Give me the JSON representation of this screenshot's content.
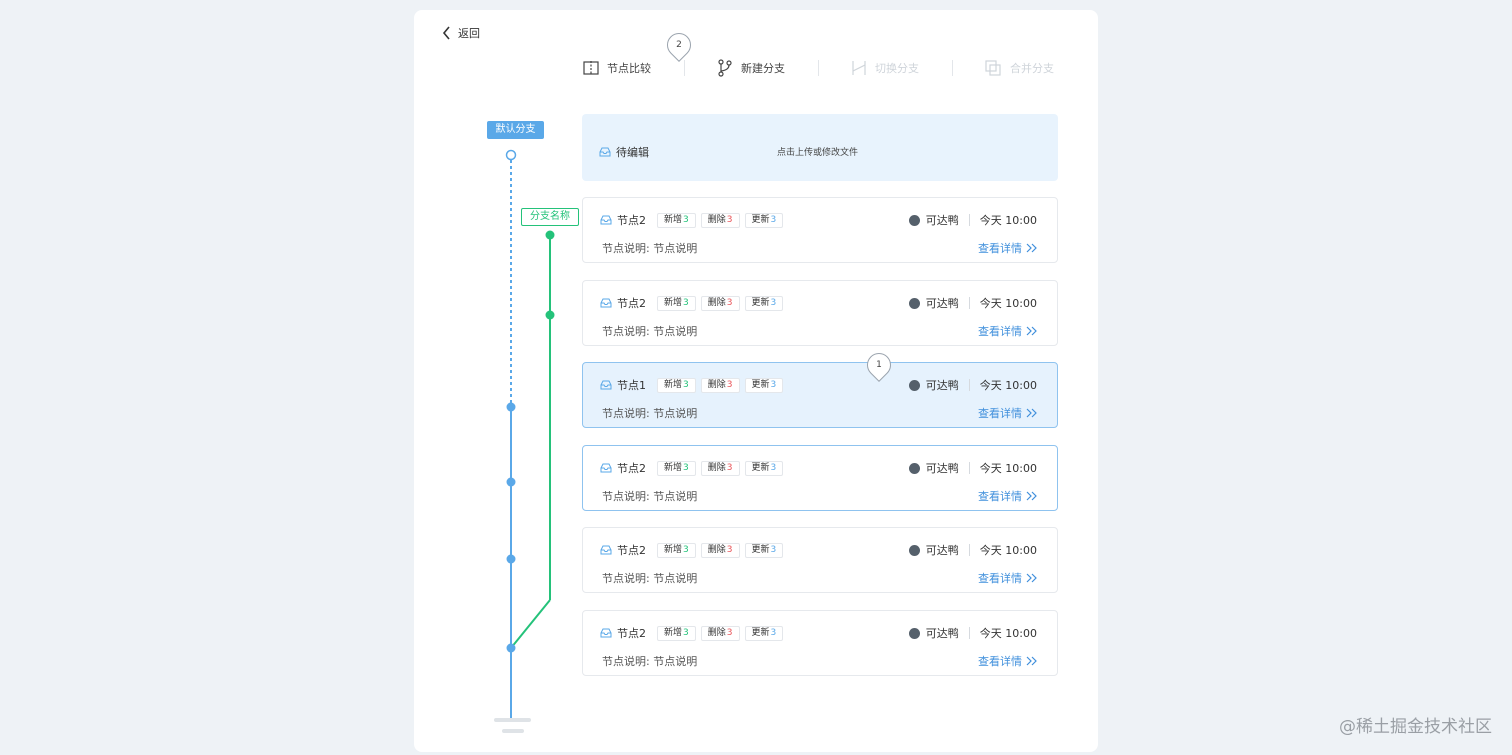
{
  "header": {
    "back_label": "返回"
  },
  "toolbar": {
    "compare": "节点比较",
    "new_branch": "新建分支",
    "switch_branch": "切换分支",
    "merge_branch": "合并分支"
  },
  "markers": {
    "top": "2",
    "mid": "1"
  },
  "graph": {
    "default_branch_label": "默认分支",
    "branch_name_label": "分支名称",
    "colors": {
      "main": "#5aa8e8",
      "branch": "#24c27a"
    }
  },
  "pending": {
    "title": "待编辑",
    "hint": "点击上传或修改文件"
  },
  "cards": [
    {
      "name": "节点2",
      "added_label": "新增",
      "added": "3",
      "deleted_label": "删除",
      "deleted": "3",
      "updated_label": "更新",
      "updated": "3",
      "user": "可达鸭",
      "time": "今天 10:00",
      "desc_label": "节点说明:",
      "desc": "节点说明",
      "detail": "查看详情"
    },
    {
      "name": "节点2",
      "added_label": "新增",
      "added": "3",
      "deleted_label": "删除",
      "deleted": "3",
      "updated_label": "更新",
      "updated": "3",
      "user": "可达鸭",
      "time": "今天 10:00",
      "desc_label": "节点说明:",
      "desc": "节点说明",
      "detail": "查看详情"
    },
    {
      "name": "节点1",
      "added_label": "新增",
      "added": "3",
      "deleted_label": "删除",
      "deleted": "3",
      "updated_label": "更新",
      "updated": "3",
      "user": "可达鸭",
      "time": "今天 10:00",
      "desc_label": "节点说明:",
      "desc": "节点说明",
      "detail": "查看详情"
    },
    {
      "name": "节点2",
      "added_label": "新增",
      "added": "3",
      "deleted_label": "删除",
      "deleted": "3",
      "updated_label": "更新",
      "updated": "3",
      "user": "可达鸭",
      "time": "今天 10:00",
      "desc_label": "节点说明:",
      "desc": "节点说明",
      "detail": "查看详情"
    },
    {
      "name": "节点2",
      "added_label": "新增",
      "added": "3",
      "deleted_label": "删除",
      "deleted": "3",
      "updated_label": "更新",
      "updated": "3",
      "user": "可达鸭",
      "time": "今天 10:00",
      "desc_label": "节点说明:",
      "desc": "节点说明",
      "detail": "查看详情"
    },
    {
      "name": "节点2",
      "added_label": "新增",
      "added": "3",
      "deleted_label": "删除",
      "deleted": "3",
      "updated_label": "更新",
      "updated": "3",
      "user": "可达鸭",
      "time": "今天 10:00",
      "desc_label": "节点说明:",
      "desc": "节点说明",
      "detail": "查看详情"
    }
  ],
  "watermark": "@稀土掘金技术社区"
}
